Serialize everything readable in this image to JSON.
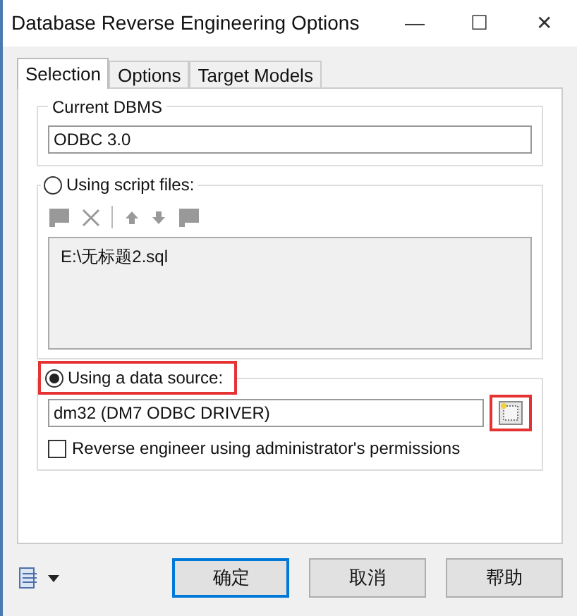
{
  "window": {
    "title": "Database Reverse Engineering Options",
    "controls": [
      "—",
      "☐",
      "✕"
    ]
  },
  "tabs": [
    {
      "label": "Selection",
      "selected": true
    },
    {
      "label": "Options",
      "selected": false
    },
    {
      "label": "Target Models",
      "selected": false
    }
  ],
  "current_dbms": {
    "label": "Current DBMS",
    "value": "ODBC 3.0"
  },
  "script_files": {
    "label": "Using script files:",
    "selected": false,
    "highlighted": false,
    "files": [
      "E:\\无标题2.sql"
    ]
  },
  "data_source": {
    "label": "Using a data source:",
    "selected": true,
    "highlighted": true,
    "value": "dm32 (DM7 ODBC DRIVER)",
    "browse_highlighted": true
  },
  "admin_permissions": {
    "label": "Reverse engineer using administrator's permissions",
    "checked": false
  },
  "buttons": [
    {
      "label": "确定",
      "default": true
    },
    {
      "label": "取消",
      "default": false
    },
    {
      "label": "帮助",
      "default": false
    }
  ]
}
